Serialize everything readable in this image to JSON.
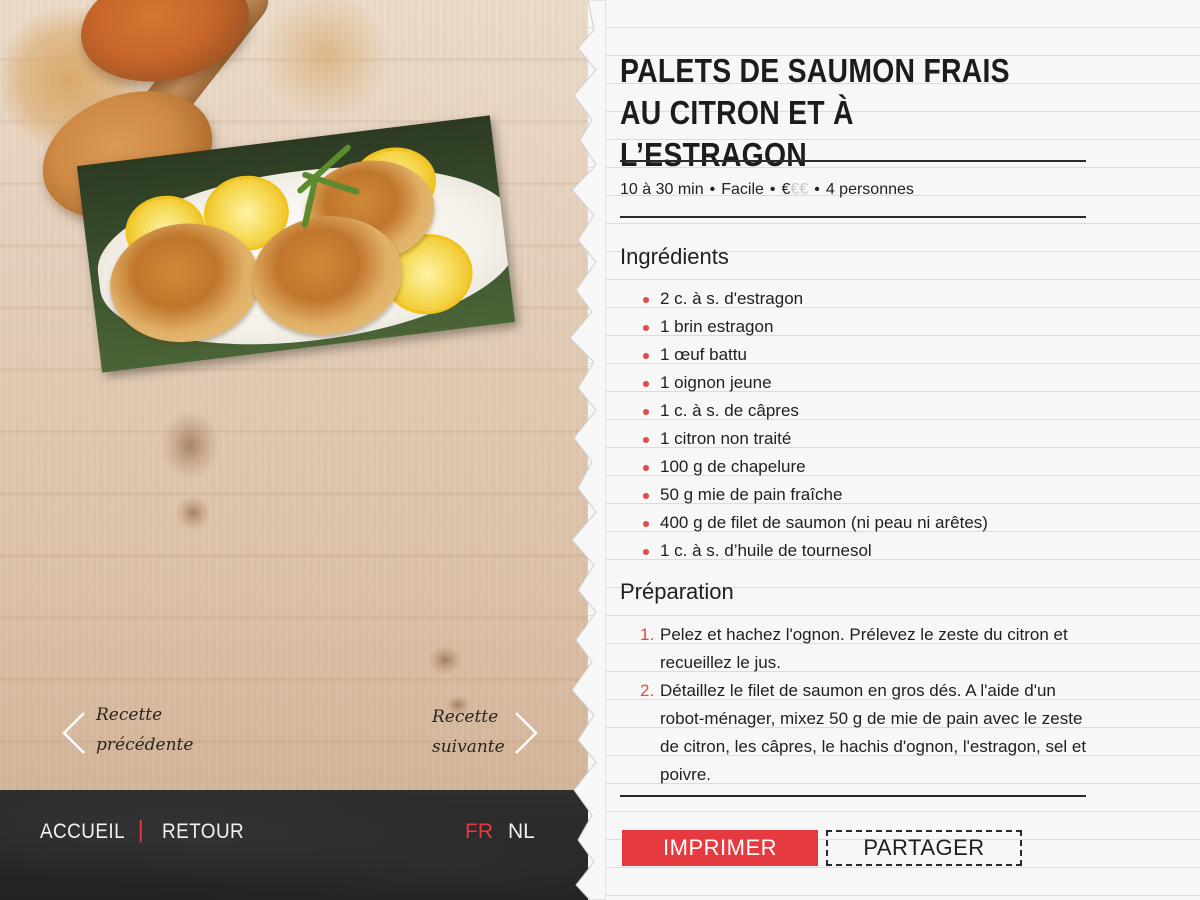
{
  "recipe": {
    "title": "Palets de saumon frais au citron et à l’estragon",
    "meta": {
      "time": "10 à 30 min",
      "difficulty": "Facile",
      "price_active": "€",
      "price_inactive": "€€",
      "servings": "4 personnes",
      "separator": "•"
    },
    "ingredients_title": "Ingrédients",
    "ingredients": [
      "2 c. à s. d'estragon",
      "1 brin estragon",
      "1 œuf battu",
      "1 oignon jeune",
      "1 c. à s. de câpres",
      "1 citron non traité",
      "100 g de chapelure",
      "50 g mie de pain fraîche",
      "400 g de filet de saumon (ni peau ni arêtes)",
      "1 c. à s. d’huile de tournesol"
    ],
    "preparation_title": "Préparation",
    "steps": [
      {
        "num": "1.",
        "text": "Pelez et hachez l'ognon. Prélevez le zeste du citron et recueillez le jus."
      },
      {
        "num": "2.",
        "text": "Détaillez le filet de saumon en gros dés. A l'aide d'un robot-ménager, mixez 50 g de mie de pain avec le zeste de citron, les câpres, le hachis d'ognon, l'estragon, sel et poivre."
      }
    ]
  },
  "actions": {
    "print_label": "IMPRIMER",
    "share_label": "PARTAGER"
  },
  "navigation": {
    "prev_line1": "Recette",
    "prev_line2": "précédente",
    "next_line1": "Recette",
    "next_line2": "suivante"
  },
  "footer": {
    "home_label": "ACCUEIL",
    "separator": "|",
    "back_label": "RETOUR",
    "lang_fr": "FR",
    "lang_nl": "NL"
  },
  "colors": {
    "accent_red": "#e43a40",
    "chalkboard": "#262626",
    "paper": "#f7f7f7"
  }
}
